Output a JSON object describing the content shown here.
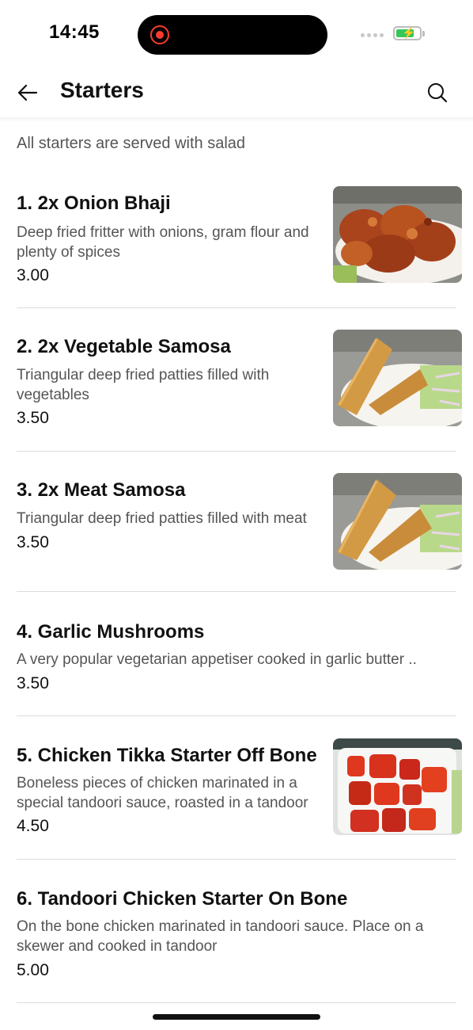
{
  "status": {
    "time": "14:45"
  },
  "header": {
    "title": "Starters"
  },
  "subtitle": "All starters are served with salad",
  "items": [
    {
      "name": "1. 2x Onion Bhaji",
      "description": "Deep fried fritter with onions, gram flour and plenty of spices",
      "price": "3.00"
    },
    {
      "name": "2. 2x Vegetable Samosa",
      "description": "Triangular deep fried patties filled with vegetables",
      "price": "3.50"
    },
    {
      "name": "3. 2x Meat Samosa",
      "description": "Triangular deep fried patties filled with meat",
      "price": "3.50"
    },
    {
      "name": "4. Garlic Mushrooms",
      "description": "A very popular vegetarian appetiser cooked in garlic butter ..",
      "price": "3.50"
    },
    {
      "name": "5. Chicken Tikka Starter Off Bone",
      "description": "Boneless pieces of chicken marinated in a special tandoori sauce, roasted in a tandoor",
      "price": "4.50"
    },
    {
      "name": "6. Tandoori Chicken Starter On Bone",
      "description": "On the bone chicken marinated in tandoori sauce. Place on a skewer and cooked in tandoor",
      "price": "5.00"
    }
  ],
  "icons": {
    "back": "arrow-left-icon",
    "search": "search-icon"
  },
  "colors": {
    "accent_battery": "#34c759",
    "record": "#ff3b30"
  }
}
